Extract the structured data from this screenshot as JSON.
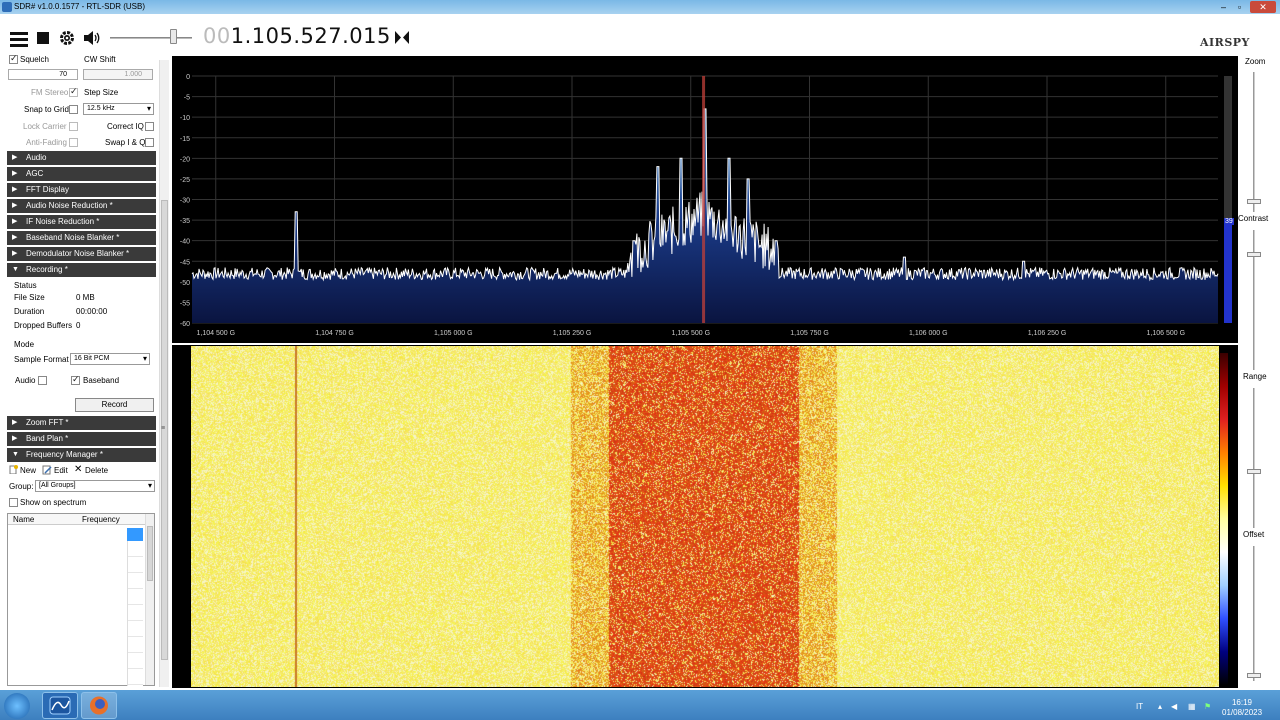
{
  "window": {
    "title": "SDR# v1.0.0.1577 - RTL-SDR (USB)"
  },
  "toolbar": {
    "freq_prefix": "00",
    "freq_main": "1.105.527.015",
    "logo": "AIRSPY"
  },
  "sidebar": {
    "squelch_label": "Squelch",
    "cw_shift_label": "CW Shift",
    "squelch_value": "70",
    "cw_shift_value": "1.000",
    "fm_stereo_label": "FM Stereo",
    "step_size_label": "Step Size",
    "snap_to_grid_label": "Snap to Grid",
    "step_size_value": "12.5 kHz",
    "lock_carrier_label": "Lock Carrier",
    "correct_iq_label": "Correct IQ",
    "anti_fading_label": "Anti-Fading",
    "swap_iq_label": "Swap I & Q",
    "panels": [
      "Audio",
      "AGC",
      "FFT Display",
      "Audio Noise Reduction *",
      "IF Noise Reduction *",
      "Baseband Noise Blanker *",
      "Demodulator Noise Blanker *",
      "Recording *"
    ],
    "recording": {
      "status_label": "Status",
      "file_size_label": "File Size",
      "file_size_value": "0 MB",
      "duration_label": "Duration",
      "duration_value": "00:00:00",
      "dropped_label": "Dropped Buffers",
      "dropped_value": "0",
      "mode_label": "Mode",
      "sample_format_label": "Sample Format",
      "sample_format_value": "16 Bit PCM",
      "audio_label": "Audio",
      "baseband_label": "Baseband",
      "record_button": "Record"
    },
    "panels2": [
      "Zoom FFT *",
      "Band Plan *",
      "Frequency Manager *"
    ],
    "freqmgr": {
      "new_label": "New",
      "edit_label": "Edit",
      "delete_label": "Delete",
      "group_label": "Group:",
      "group_value": "[All Groups]",
      "show_on_spectrum_label": "Show on spectrum",
      "col_name": "Name",
      "col_frequency": "Frequency"
    }
  },
  "right": {
    "zoom_label": "Zoom",
    "contrast_label": "Contrast",
    "range_label": "Range",
    "offset_label": "Offset",
    "range_value": "39"
  },
  "chart_data": {
    "type": "line",
    "title": "",
    "xlabel": "",
    "ylabel": "",
    "ylim": [
      -60,
      0
    ],
    "xlim": [
      1.10445,
      1.10661
    ],
    "y_ticks": [
      "0",
      "-5",
      "-10",
      "-15",
      "-20",
      "-25",
      "-30",
      "-35",
      "-40",
      "-45",
      "-50",
      "-55",
      "-60"
    ],
    "x_ticks": [
      "1,104 500 G",
      "1,104 750 G",
      "1,105 000 G",
      "1,105 250 G",
      "1,105 500 G",
      "1,105 750 G",
      "1,106 000 G",
      "1,106 250 G",
      "1,106 500 G"
    ],
    "x_tick_values": [
      1.1045,
      1.10475,
      1.105,
      1.10525,
      1.1055,
      1.10575,
      1.106,
      1.10625,
      1.1065
    ],
    "tuned_frequency": 1.105527,
    "noise_floor": -48,
    "peaks": [
      {
        "x": 1.10467,
        "y": -33
      },
      {
        "x": 1.10538,
        "y": -40
      },
      {
        "x": 1.10543,
        "y": -22
      },
      {
        "x": 1.10548,
        "y": -20
      },
      {
        "x": 1.10553,
        "y": -8
      },
      {
        "x": 1.10558,
        "y": -20
      },
      {
        "x": 1.10562,
        "y": -25
      },
      {
        "x": 1.10568,
        "y": -40
      },
      {
        "x": 1.10595,
        "y": -44
      },
      {
        "x": 1.1062,
        "y": -45
      }
    ]
  },
  "taskbar": {
    "language": "IT",
    "time": "16:19",
    "date": "01/08/2023"
  }
}
